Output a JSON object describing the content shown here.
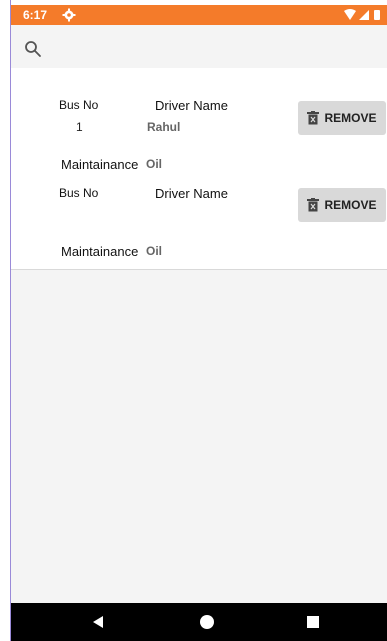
{
  "status_bar": {
    "time": "6:17",
    "color": "#f47b2a"
  },
  "icons": {
    "search": "search-icon",
    "settings": "gear-icon",
    "remove": "trash-icon"
  },
  "buses": [
    {
      "bus_no_label": "Bus No",
      "bus_no": "1",
      "driver_label": "Driver Name",
      "driver": "Rahul",
      "maint_label": "Maintainance",
      "maint": "Oil",
      "remove_label": "REMOVE"
    },
    {
      "bus_no_label": "Bus No",
      "bus_no": "",
      "driver_label": "Driver Name",
      "driver": "",
      "maint_label": "Maintainance",
      "maint": "Oil",
      "remove_label": "REMOVE"
    }
  ]
}
